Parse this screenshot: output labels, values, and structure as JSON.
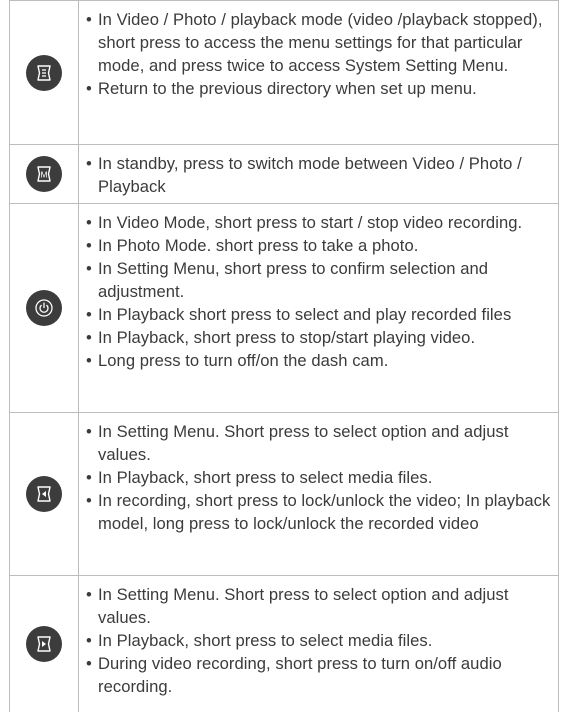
{
  "rows": [
    {
      "icon": "menu-icon",
      "items": [
        "In Video / Photo / playback mode (video /playback stopped), short press to access the menu settings for that particular mode, and press twice to access System Setting Menu.",
        "Return to the previous directory when set up menu."
      ]
    },
    {
      "icon": "mode-icon",
      "icon_letter": "M",
      "items": [
        "In standby, press to switch mode between Video / Photo / Playback"
      ]
    },
    {
      "icon": "power-ok-icon",
      "items": [
        "In Video Mode, short press to start / stop video recording.",
        "In Photo Mode. short press to take a photo.",
        "In Setting Menu, short press to confirm selection and adjustment.",
        "In Playback short press to select and play recorded files",
        "In Playback, short press to stop/start playing video.",
        "Long press to turn off/on the dash cam."
      ]
    },
    {
      "icon": "left-arrow-icon",
      "items": [
        "In Setting Menu. Short press to select option and adjust values.",
        "In Playback, short press to select media files.",
        "In recording, short press to lock/unlock the video; In playback model, long press to lock/unlock the recorded video"
      ]
    },
    {
      "icon": "right-arrow-icon",
      "items": [
        "In Setting Menu. Short press to select option and adjust values.",
        "In Playback, short press to select media files.",
        "During video recording, short press to turn on/off audio recording."
      ]
    }
  ]
}
